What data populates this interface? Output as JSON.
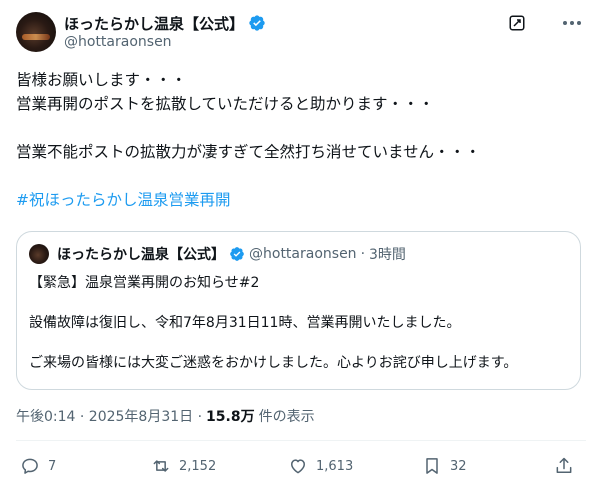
{
  "author": {
    "display_name": "ほったらかし温泉【公式】",
    "handle": "@hottaraonsen"
  },
  "tweet": {
    "lines": [
      "皆様お願いします・・・",
      "営業再開のポストを拡散していただけると助かります・・・",
      "営業不能ポストの拡散力が凄すぎて全然打ち消せていません・・・"
    ],
    "hashtag": "#祝ほったらかし温泉営業再開"
  },
  "quote": {
    "display_name": "ほったらかし温泉【公式】",
    "handle": "@hottaraonsen",
    "separator": "·",
    "time": "3時間",
    "lines": [
      "【緊急】温泉営業再開のお知らせ#2",
      "設備故障は復旧し、令和7年8月31日11時、営業再開いたしました。",
      "ご来場の皆様には大変ご迷惑をおかけしました。心よりお詫び申し上げます。"
    ]
  },
  "meta": {
    "timestamp": "午後0:14 · 2025年8月31日 ·",
    "views": "15.8万",
    "views_suffix": "件の表示"
  },
  "actions": {
    "replies": "7",
    "reposts": "2,152",
    "likes": "1,613",
    "bookmarks": "32"
  },
  "icons": [
    "verified-icon",
    "grok-icon",
    "more-icon",
    "reply-icon",
    "repost-icon",
    "like-icon",
    "bookmark-icon",
    "share-icon"
  ],
  "colors": {
    "accent": "#1d9bf0",
    "text": "#0f1419",
    "muted": "#536471",
    "border": "#cfd9de"
  }
}
